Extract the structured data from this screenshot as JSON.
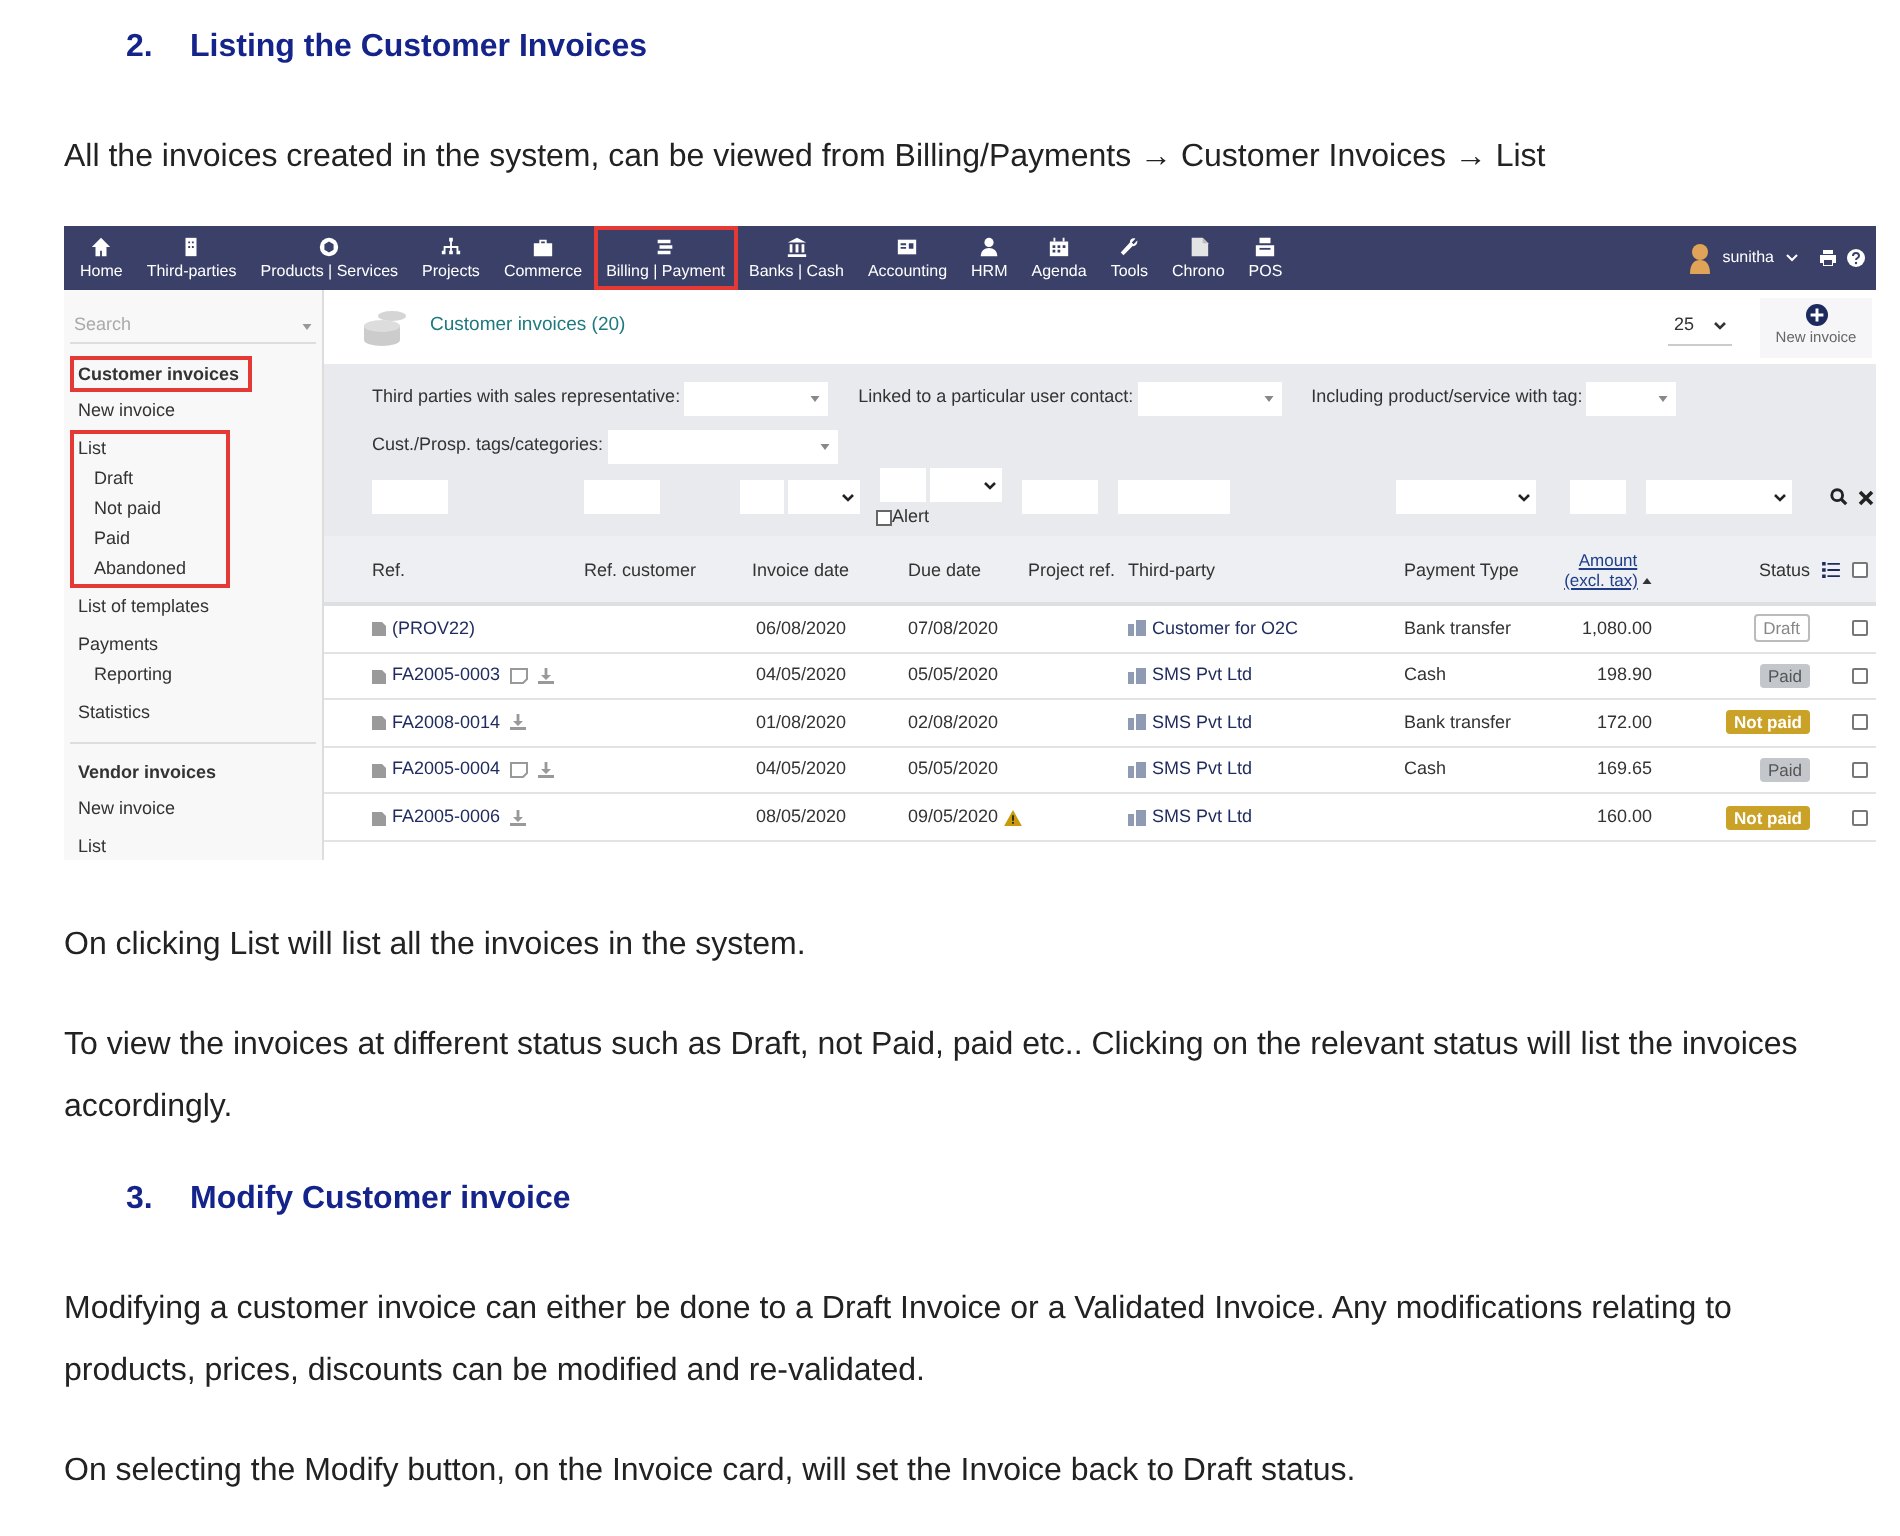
{
  "sections": [
    {
      "kind": "heading",
      "number": "2.",
      "text": "Listing the Customer Invoices"
    },
    {
      "kind": "paragraph",
      "text": "All the invoices created in the system, can be viewed from Billing/Payments → Customer Invoices → List"
    },
    {
      "kind": "screenshot"
    },
    {
      "kind": "paragraph",
      "text": "On clicking List will list all the invoices in the system."
    },
    {
      "kind": "paragraph",
      "text": "To view the invoices at different status such as Draft, not Paid, paid etc.. Clicking on the relevant status will list the invoices accordingly."
    },
    {
      "kind": "heading",
      "number": "3.",
      "text": "Modify Customer invoice"
    },
    {
      "kind": "paragraph",
      "text": "Modifying a customer invoice can either be done to a Draft Invoice or a Validated Invoice. Any modifications relating to products, prices, discounts can be modified and re-validated."
    },
    {
      "kind": "paragraph",
      "text": "On selecting the Modify button, on the Invoice card, will set the Invoice back to Draft status."
    }
  ],
  "app": {
    "menu": [
      {
        "label": "Home",
        "highlighted": false
      },
      {
        "label": "Third-parties",
        "highlighted": false
      },
      {
        "label": "Products | Services",
        "highlighted": false
      },
      {
        "label": "Projects",
        "highlighted": false
      },
      {
        "label": "Commerce",
        "highlighted": false
      },
      {
        "label": "Billing | Payment",
        "highlighted": true
      },
      {
        "label": "Banks | Cash",
        "highlighted": false
      },
      {
        "label": "Accounting",
        "highlighted": false
      },
      {
        "label": "HRM",
        "highlighted": false
      },
      {
        "label": "Agenda",
        "highlighted": false
      },
      {
        "label": "Tools",
        "highlighted": false
      },
      {
        "label": "Chrono",
        "highlighted": false
      },
      {
        "label": "POS",
        "highlighted": false
      }
    ],
    "user": "sunitha",
    "sidebar": {
      "search_placeholder": "Search",
      "sections": [
        {
          "title": "Customer invoices",
          "highlighted": true,
          "items": [
            {
              "label": "New invoice",
              "highlighted": false
            },
            {
              "label": "List",
              "highlighted": true,
              "children": [
                {
                  "label": "Draft"
                },
                {
                  "label": "Not paid"
                },
                {
                  "label": "Paid"
                },
                {
                  "label": "Abandoned"
                }
              ]
            },
            {
              "label": "List of templates",
              "highlighted": false
            },
            {
              "label": "Payments",
              "highlighted": false,
              "children": [
                {
                  "label": "Reporting"
                }
              ]
            },
            {
              "label": "Statistics",
              "highlighted": false
            }
          ]
        },
        {
          "title": "Vendor invoices",
          "highlighted": false,
          "items": [
            {
              "label": "New invoice",
              "highlighted": false
            },
            {
              "label": "List",
              "highlighted": false
            }
          ]
        }
      ]
    },
    "title": "Customer invoices (20)",
    "page_size": "25",
    "new_button": "New invoice",
    "filters": [
      "Third parties with sales representative:",
      "Linked to a particular user contact:",
      "Including product/service with tag:",
      "Cust./Prosp. tags/categories:"
    ],
    "alert": {
      "label": "Alert",
      "checked": false
    },
    "table": {
      "columns": [
        "Ref.",
        "Ref. customer",
        "Invoice date",
        "Due date",
        "Project ref.",
        "Third-party",
        "Payment Type",
        "Amount (excl. tax)",
        "Status"
      ],
      "select_all_checked": false,
      "rows": [
        {
          "ref": "(PROV22)",
          "note": false,
          "download": false,
          "invoice_date": "06/08/2020",
          "due_date": "07/08/2020",
          "warning": false,
          "third_party": "Customer for O2C",
          "payment_type": "Bank transfer",
          "amount": "1,080.00",
          "status": {
            "label": "Draft",
            "kind": "draft"
          },
          "checked": false
        },
        {
          "ref": "FA2005-0003",
          "note": true,
          "download": true,
          "invoice_date": "04/05/2020",
          "due_date": "05/05/2020",
          "warning": false,
          "third_party": "SMS Pvt Ltd",
          "payment_type": "Cash",
          "amount": "198.90",
          "status": {
            "label": "Paid",
            "kind": "paid"
          },
          "checked": false
        },
        {
          "ref": "FA2008-0014",
          "note": false,
          "download": true,
          "invoice_date": "01/08/2020",
          "due_date": "02/08/2020",
          "warning": false,
          "third_party": "SMS Pvt Ltd",
          "payment_type": "Bank transfer",
          "amount": "172.00",
          "status": {
            "label": "Not paid",
            "kind": "not_paid"
          },
          "checked": false
        },
        {
          "ref": "FA2005-0004",
          "note": true,
          "download": true,
          "invoice_date": "04/05/2020",
          "due_date": "05/05/2020",
          "warning": false,
          "third_party": "SMS Pvt Ltd",
          "payment_type": "Cash",
          "amount": "169.65",
          "status": {
            "label": "Paid",
            "kind": "paid"
          },
          "checked": false
        },
        {
          "ref": "FA2005-0006",
          "note": false,
          "download": true,
          "invoice_date": "08/05/2020",
          "due_date": "09/05/2020",
          "warning": true,
          "third_party": "SMS Pvt Ltd",
          "amount": "160.00",
          "status": {
            "label": "Not paid",
            "kind": "not_paid"
          },
          "checked": false
        }
      ]
    }
  }
}
